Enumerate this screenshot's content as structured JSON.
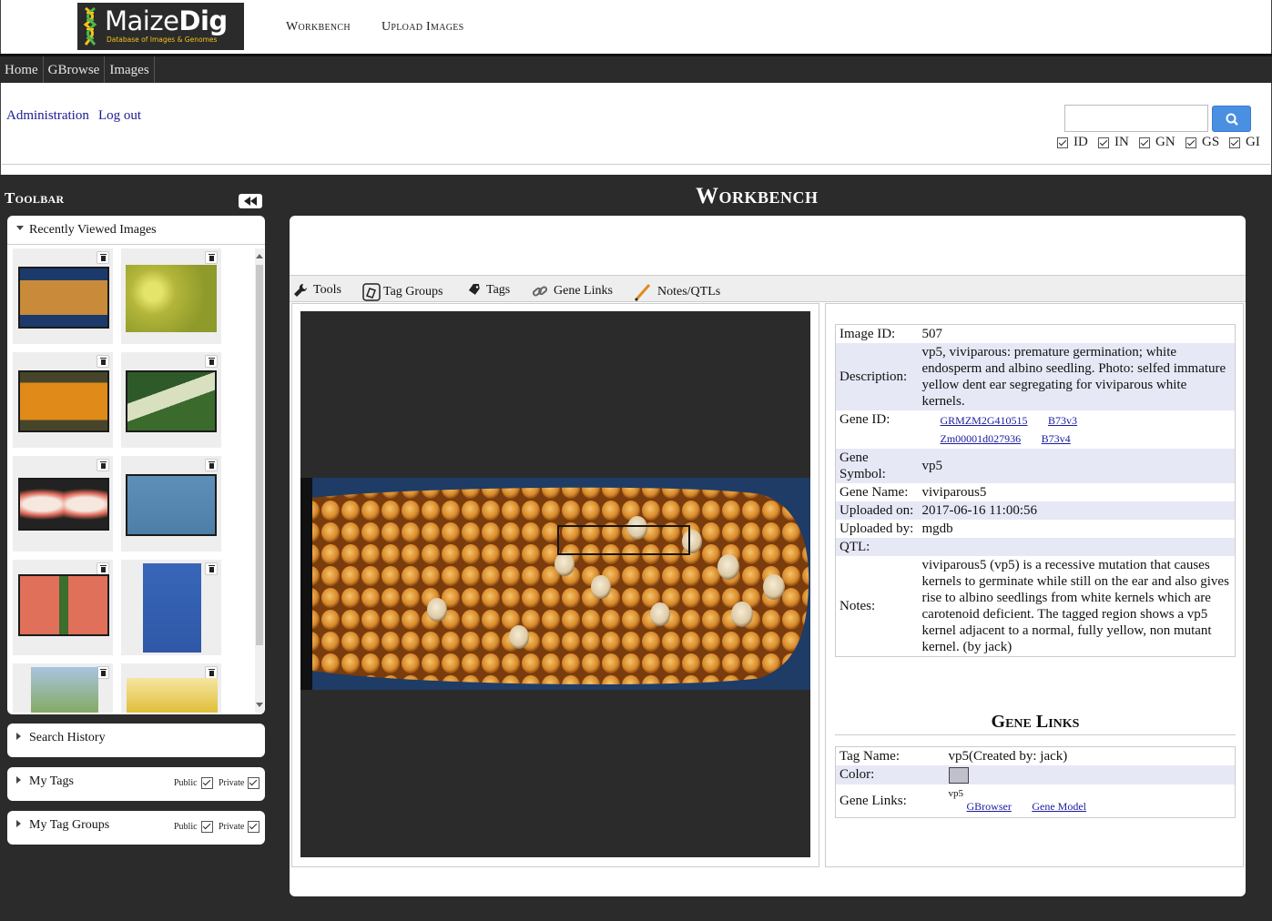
{
  "header": {
    "logo_text_light": "Maize",
    "logo_text_bold": "Dig",
    "logo_subtitle": "Database of Images & Genomes",
    "links": [
      "Workbench",
      "Upload Images"
    ]
  },
  "nav": {
    "items": [
      "Home",
      "GBrowse",
      "Images"
    ]
  },
  "admin": {
    "links": [
      "Administration",
      "Log out"
    ]
  },
  "search": {
    "value": "",
    "checkboxes": [
      {
        "label": "ID",
        "checked": true
      },
      {
        "label": "IN",
        "checked": true
      },
      {
        "label": "GN",
        "checked": true
      },
      {
        "label": "GS",
        "checked": true
      },
      {
        "label": "GI",
        "checked": true
      }
    ]
  },
  "toolbar": {
    "title": "Toolbar",
    "recent_title": "Recently Viewed Images",
    "search_history": "Search History",
    "my_tags": "My Tags",
    "my_tag_groups": "My Tag Groups",
    "public_label": "Public",
    "private_label": "Private"
  },
  "workbench": {
    "title": "Workbench",
    "tabs": [
      "Tools",
      "Tag Groups",
      "Tags",
      "Gene Links",
      "Notes/QTLs"
    ]
  },
  "image_info": {
    "labels": {
      "image_id": "Image ID:",
      "description": "Description:",
      "gene_id": "Gene ID:",
      "gene_symbol": "Gene Symbol:",
      "gene_name": "Gene Name:",
      "uploaded_on": "Uploaded on:",
      "uploaded_by": "Uploaded by:",
      "qtl": "QTL:",
      "notes": "Notes:"
    },
    "image_id": "507",
    "description": "vp5, viviparous: premature germination; white endosperm and albino seedling. Photo: selfed immature yellow dent ear segregating for viviparous white kernels.",
    "gene_ids": [
      {
        "id": "GRMZM2G410515",
        "version": "B73v3"
      },
      {
        "id": "Zm00001d027936",
        "version": "B73v4"
      }
    ],
    "gene_symbol": "vp5",
    "gene_name": "viviparous5",
    "uploaded_on": "2017-06-16 11:00:56",
    "uploaded_by": "mgdb",
    "qtl": "",
    "notes": "viviparous5 (vp5) is a recessive mutation that causes kernels to germinate while still on the ear and also gives rise to albino seedlings from white kernels which are carotenoid deficient. The tagged region shows a vp5 kernel adjacent to a normal, fully yellow, non mutant kernel. (by jack)"
  },
  "gene_links": {
    "title": "Gene Links",
    "labels": {
      "tag_name": "Tag Name:",
      "color": "Color:",
      "gene_links": "Gene Links:"
    },
    "tag_name": "vp5(Created by: jack)",
    "color": "#c0c0cc",
    "gene_symbol": "vp5",
    "links": [
      "GBrowser",
      "Gene Model"
    ]
  },
  "colors": {
    "dark_bg": "#2b2b2b",
    "accent_blue": "#4a90e2",
    "row_alt": "#e6e8f6",
    "logo_yellow": "#f4c21b"
  }
}
